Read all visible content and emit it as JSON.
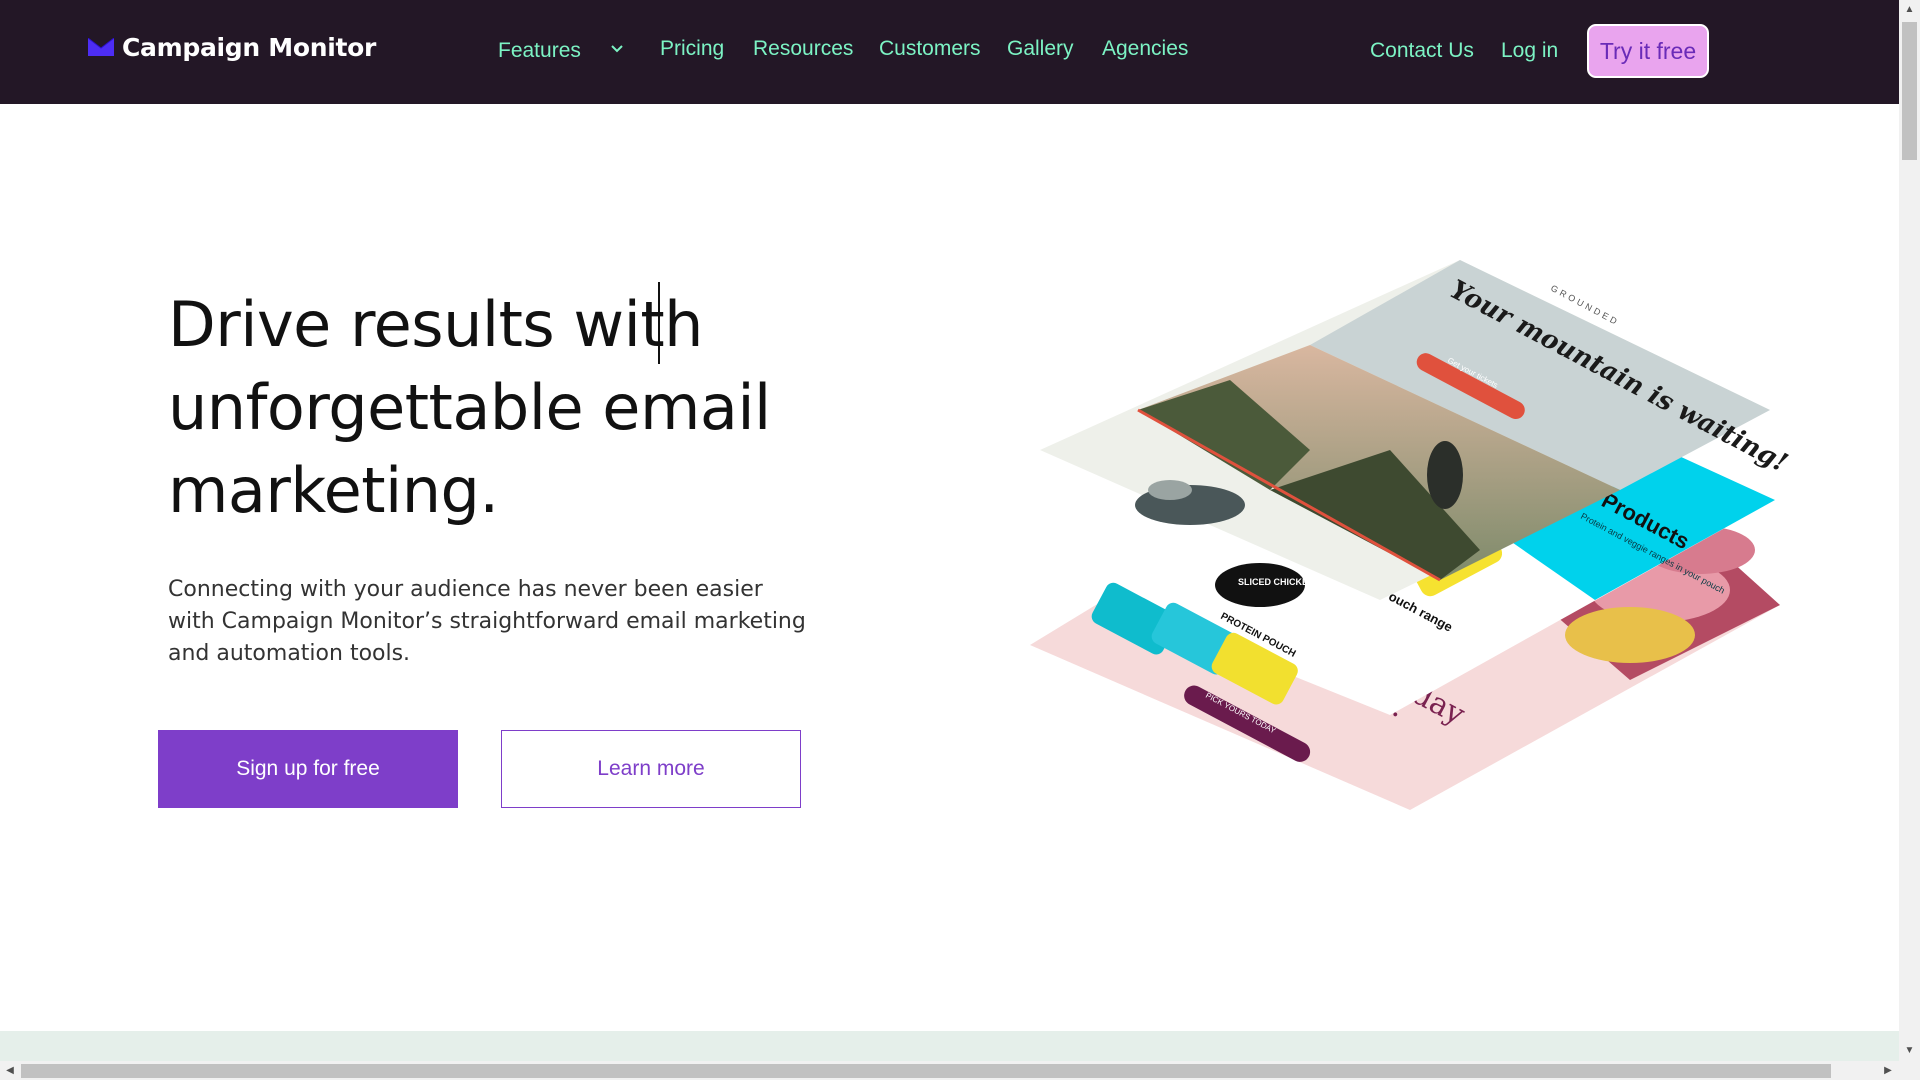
{
  "brand": {
    "name": "Campaign Monitor",
    "accent": "#7e3ec9",
    "nav_bg": "#231726",
    "nav_text": "#7cf3c4"
  },
  "nav": {
    "features": "Features",
    "pricing": "Pricing",
    "resources": "Resources",
    "customers": "Customers",
    "gallery": "Gallery",
    "agencies": "Agencies",
    "contact": "Contact Us",
    "login": "Log in",
    "try_free": "Try it free"
  },
  "hero": {
    "title_line1": "Drive results with",
    "title_line2": "unforgettable email",
    "title_line3": "marketing.",
    "description": "Connecting with your audience has never been easier with Campaign Monitor’s straightforward email marketing and automation tools.",
    "primary_cta": "Sign up for free",
    "secondary_cta": "Learn more"
  },
  "illustration": {
    "grounded_brand": "GROUNDED",
    "grounded_headline": "Your mountain is waiting!",
    "grounded_cta": "Get your tickets",
    "products_title": "Products",
    "products_body": "Protein and veggie ranges in your pouch",
    "pouch_range": "Pouch range",
    "sliced_chicken": "SLICED CHICKEN",
    "protein_pouch": "PROTEIN POUCH",
    "day_text": "day",
    "er_text": "er.",
    "pick_cta": "PICK YOURS TODAY"
  }
}
